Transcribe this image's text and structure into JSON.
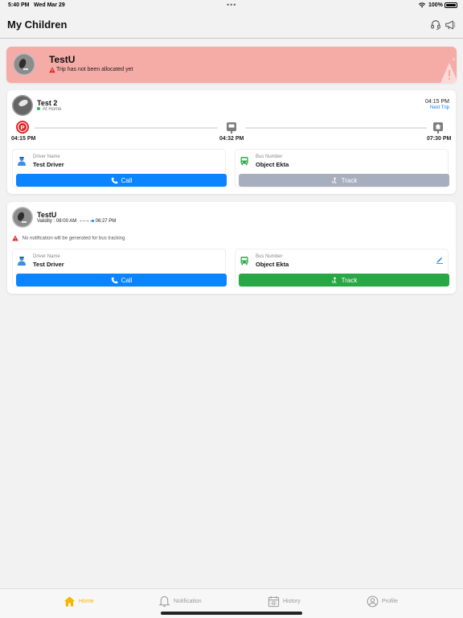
{
  "status_bar": {
    "time": "5:40 PM",
    "date": "Wed Mar 29",
    "battery": "100%"
  },
  "header": {
    "title": "My Children",
    "icons": [
      "headset-icon",
      "megaphone-icon"
    ]
  },
  "alert_card": {
    "name": "TestU",
    "message": "Trip has not been allocated yet",
    "color": "#f5aba6"
  },
  "trip_card": {
    "name": "Test 2",
    "status": "At Home",
    "next_time": "04:15 PM",
    "next_trip_label": "Next Trip",
    "stops": [
      {
        "time": "04:15 PM",
        "icon": "parking-icon"
      },
      {
        "time": "04:32 PM",
        "icon": "bus-stop-icon"
      },
      {
        "time": "07:30 PM",
        "icon": "school-icon"
      }
    ],
    "driver_label": "Driver Name",
    "driver_name": "Test Driver",
    "bus_label": "Bus Number",
    "bus_number": "Object Ekta",
    "call_label": "Call",
    "track_label": "Track"
  },
  "child_card": {
    "name": "TestU",
    "validity_label": "Validity :",
    "validity_start": "08:00 AM",
    "validity_end": "06:27 PM",
    "note": "No notification will be generated for bus tracking",
    "driver_label": "Driver Name",
    "driver_name": "Test Driver",
    "bus_label": "Bus Number",
    "bus_number": "Object Ekta",
    "call_label": "Call",
    "track_label": "Track"
  },
  "nav": {
    "home": "Home",
    "notification": "Notification",
    "history": "History",
    "profile": "Profile",
    "active_color": "#f7b500"
  },
  "colors": {
    "primary_blue": "#0a84ff",
    "green": "#28a745",
    "disabled": "#a7afbe"
  }
}
